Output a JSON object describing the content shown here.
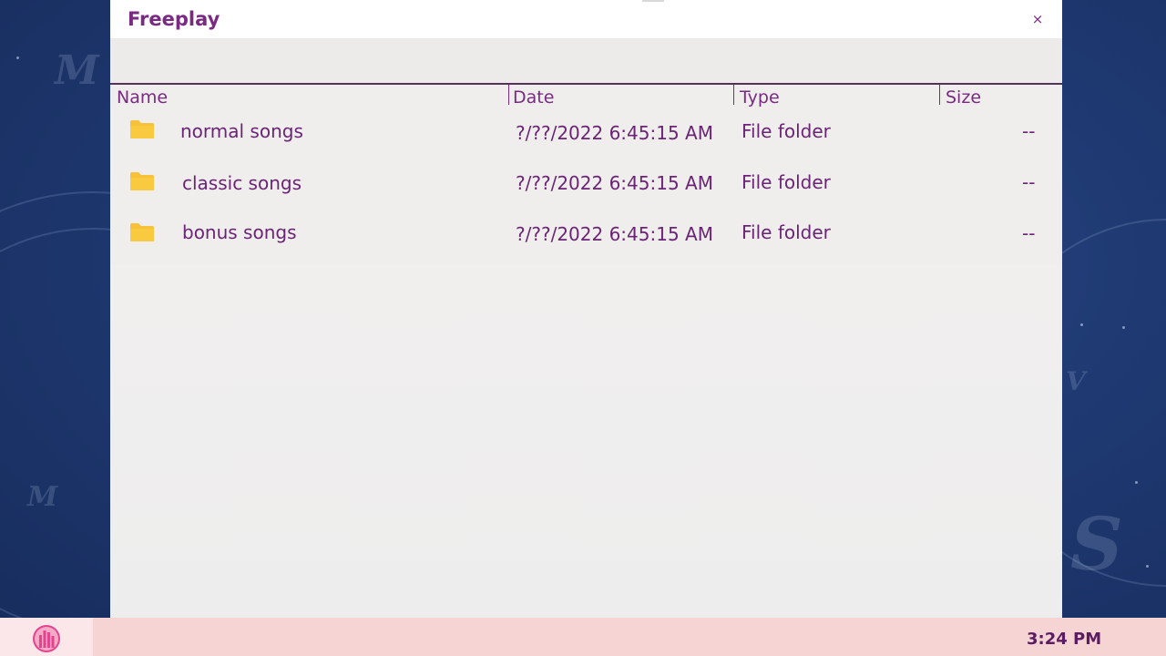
{
  "window": {
    "title": "Freeplay",
    "close_label": "×"
  },
  "columns": {
    "name": "Name",
    "date": "Date",
    "type": "Type",
    "size": "Size"
  },
  "files": [
    {
      "name": "normal songs",
      "date": "?/??/2022  6:45:15 AM",
      "type": "File folder",
      "size": "--",
      "icon": "folder-icon"
    },
    {
      "name": "classic songs",
      "date": "?/??/2022  6:45:15 AM",
      "type": "File folder",
      "size": "--",
      "icon": "folder-icon"
    },
    {
      "name": "bonus songs",
      "date": "?/??/2022  6:45:15 AM",
      "type": "File folder",
      "size": "--",
      "icon": "folder-icon"
    }
  ],
  "taskbar": {
    "clock": "3:24 PM",
    "start_icon": "city-logo-icon"
  },
  "colors": {
    "accent": "#7a2a82",
    "folder": "#f7c23a",
    "taskbar": "#f6d4d4"
  }
}
